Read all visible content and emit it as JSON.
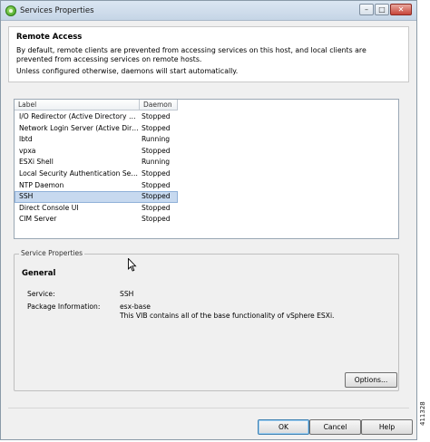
{
  "window": {
    "title": "Services Properties",
    "minimize_glyph": "–",
    "maximize_glyph": "□",
    "close_glyph": "✕"
  },
  "remote_access": {
    "title": "Remote Access",
    "description": "By default, remote clients are prevented from accessing services on this host, and local clients are prevented from accessing services on remote hosts.",
    "note": "Unless configured otherwise, daemons will start automatically."
  },
  "services_table": {
    "columns": [
      "Label",
      "Daemon"
    ],
    "rows": [
      {
        "label": "I/O Redirector (Active Directory Se...",
        "daemon": "Stopped"
      },
      {
        "label": "Network Login Server (Active Direc...",
        "daemon": "Stopped"
      },
      {
        "label": "lbtd",
        "daemon": "Running"
      },
      {
        "label": "vpxa",
        "daemon": "Stopped"
      },
      {
        "label": "ESXi Shell",
        "daemon": "Running"
      },
      {
        "label": "Local Security Authentication Serv...",
        "daemon": "Stopped"
      },
      {
        "label": "NTP Daemon",
        "daemon": "Stopped"
      },
      {
        "label": "SSH",
        "daemon": "Stopped",
        "selected": true
      },
      {
        "label": "Direct Console UI",
        "daemon": "Stopped"
      },
      {
        "label": "CIM Server",
        "daemon": "Stopped"
      }
    ]
  },
  "service_properties": {
    "legend": "Service Properties",
    "section_title": "General",
    "service_label": "Service:",
    "service_value": "SSH",
    "package_label": "Package Information:",
    "package_name": "esx-base",
    "package_desc": "This VIB contains all of the base functionality of vSphere ESXi.",
    "options_button": "Options..."
  },
  "footer": {
    "ok": "OK",
    "cancel": "Cancel",
    "help": "Help"
  },
  "figure_id": "411328",
  "colors": {
    "selection": "#c7d9ef",
    "title_bar": "#c5d5e6"
  }
}
